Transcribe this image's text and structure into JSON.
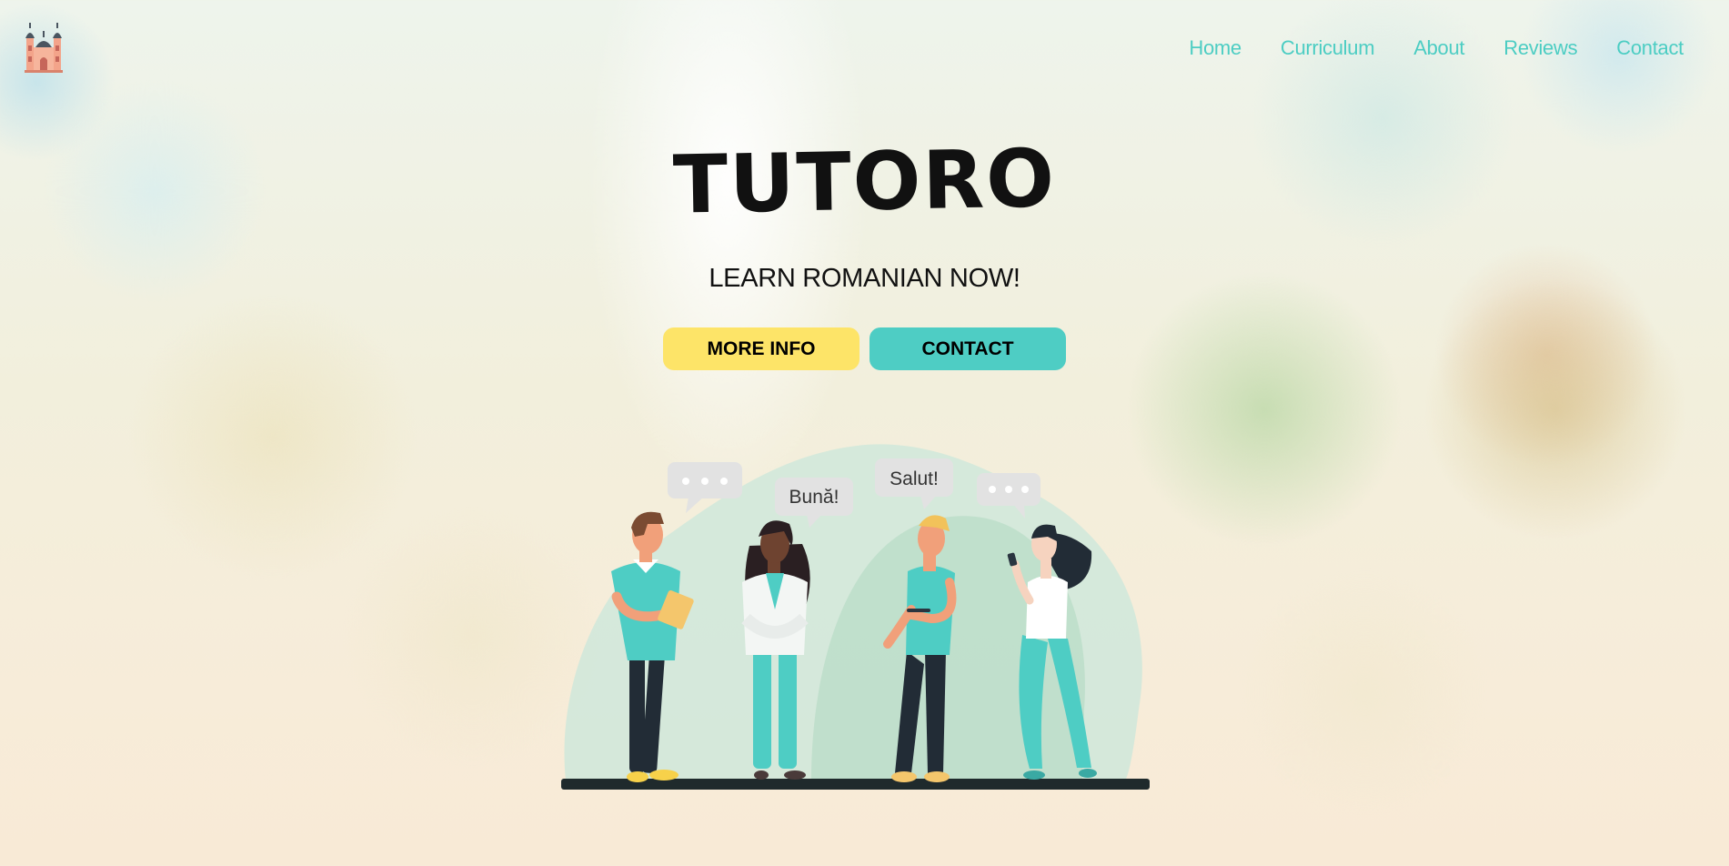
{
  "header": {
    "logo_icon": "romanian-church-logo",
    "nav": [
      {
        "label": "Home"
      },
      {
        "label": "Curriculum"
      },
      {
        "label": "About"
      },
      {
        "label": "Reviews"
      },
      {
        "label": "Contact"
      }
    ]
  },
  "hero": {
    "title": "TUTORO",
    "tagline": "LEARN ROMANIAN NOW!",
    "buttons": {
      "more_info": "MORE INFO",
      "contact": "CONTACT"
    },
    "illustration": {
      "bubble_buna": "Bună!",
      "bubble_salut": "Salut!"
    }
  },
  "colors": {
    "accent_teal": "#4ecdc4",
    "accent_yellow": "#fde468",
    "nav_text": "#4ccdc3"
  }
}
